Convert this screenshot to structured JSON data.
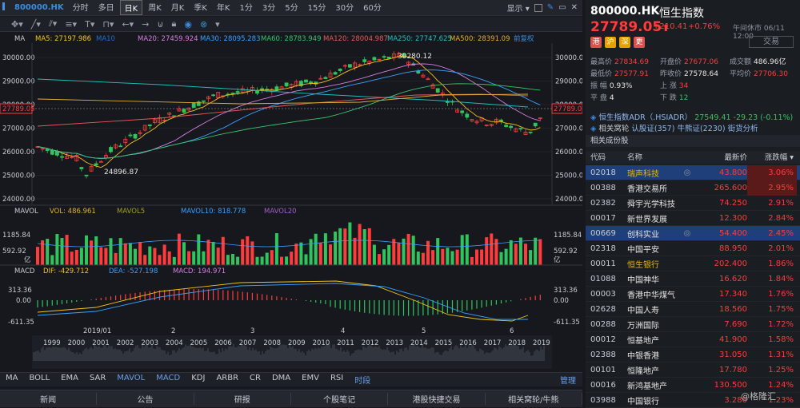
{
  "topbar": {
    "symbol": "800000.HK",
    "periods": [
      "分时",
      "多日",
      "日K",
      "周K",
      "月K",
      "季K",
      "年K",
      "1分",
      "3分",
      "5分",
      "15分",
      "30分",
      "60分"
    ],
    "active_period": "日K",
    "display_label": "显示"
  },
  "indicators": {
    "ma_label": "MA",
    "ma": [
      {
        "label": "MA5: 27197.986",
        "color": "#f0c419"
      },
      {
        "label": "MA10",
        "color": "#1f6fd0"
      },
      {
        "label": "MA20: 27459.924",
        "color": "#d67fe0"
      },
      {
        "label": "MA30: 28095.283",
        "color": "#3aa0ff"
      },
      {
        "label": "MA60: 28783.949",
        "color": "#36c46b"
      },
      {
        "label": "MA120: 28004.987",
        "color": "#e85a5a"
      },
      {
        "label": "MA250: 27747.625",
        "color": "#20c0c0"
      },
      {
        "label": "MA500: 28391.09",
        "color": "#e0b030"
      }
    ],
    "fq": "前复权",
    "vol_label": "MAVOL",
    "vol": [
      {
        "label": "VOL: 486.961",
        "color": "#e0b030"
      },
      {
        "label": "MAVOL5",
        "color": "#a0a020"
      },
      {
        "label": "MAVOL10: 818.778",
        "color": "#3aa0ff"
      },
      {
        "label": "MAVOL20",
        "color": "#a060c0"
      }
    ],
    "macd_label": "MACD",
    "macd": [
      {
        "label": "DIF: -429.712",
        "color": "#f0c419"
      },
      {
        "label": "DEA: -527.198",
        "color": "#3aa0ff"
      },
      {
        "label": "MACD: 194.971",
        "color": "#d67fe0"
      }
    ]
  },
  "price_axis": {
    "ticks": [
      "30000.00",
      "29000.00",
      "28000.00",
      "27000.00",
      "26000.00",
      "25000.00",
      "24000.00"
    ],
    "right_ticks": [
      "30000.00",
      "29000.00",
      "28000.00",
      "27000.00",
      "26000.00",
      "25000.00",
      "24000.00"
    ],
    "current": "27789.05",
    "high_label": "30280.12",
    "low_label": "24896.87"
  },
  "vol_axis": {
    "top": "1185.84",
    "mid": "592.92",
    "unit": "亿"
  },
  "macd_axis": {
    "top": "313.36",
    "zero": "0.00",
    "bottom": "-611.35"
  },
  "timeline": {
    "month_labels": [
      "2019/01",
      "2",
      "3",
      "4",
      "5",
      "6"
    ],
    "year_labels": [
      "1999",
      "2000",
      "2001",
      "2002",
      "2003",
      "2004",
      "2005",
      "2006",
      "2007",
      "2008",
      "2009",
      "2010",
      "2011",
      "2012",
      "2013",
      "2014",
      "2015",
      "2016",
      "2017",
      "2018",
      "2019"
    ]
  },
  "tabs": [
    "MA",
    "BOLL",
    "EMA",
    "SAR",
    "MAVOL",
    "MACD",
    "KDJ",
    "ARBR",
    "CR",
    "DMA",
    "EMV",
    "RSI",
    "时段"
  ],
  "manage": "管理",
  "bottom_nav": [
    "新闻",
    "公告",
    "研报",
    "个股笔记",
    "港股快捷交易",
    "相关窝轮/牛熊"
  ],
  "quote": {
    "symbol": "800000.HK",
    "name": "恒生指数",
    "price": "27789.05",
    "change": "+210.41",
    "change_pct": "+0.76%",
    "status_time": "午间休市 06/11 12:00",
    "trade": "交易",
    "badges": [
      "港",
      "沪",
      "深",
      "更"
    ],
    "stats": [
      {
        "k": "最高价",
        "v": "27834.69",
        "c": "red"
      },
      {
        "k": "开盘价",
        "v": "27677.06",
        "c": "red"
      },
      {
        "k": "成交额",
        "v": "486.96亿",
        "c": "white"
      },
      {
        "k": "最低价",
        "v": "27577.91",
        "c": "red"
      },
      {
        "k": "昨收价",
        "v": "27578.64",
        "c": "white"
      },
      {
        "k": "平均价",
        "v": "27706.30",
        "c": "red"
      },
      {
        "k": "振    幅",
        "v": "0.93%",
        "c": "white"
      },
      {
        "k": "上    涨",
        "v": "34",
        "c": "red"
      },
      {
        "k": "",
        "v": "",
        "c": "white"
      },
      {
        "k": "平    盘",
        "v": "4",
        "c": "white"
      },
      {
        "k": "下    跌",
        "v": "12",
        "c": "green"
      },
      {
        "k": "",
        "v": "",
        "c": "white"
      }
    ],
    "adr_name": "恒生指数ADR（.HSIADR）",
    "adr_price": "27549.41",
    "adr_change": "-29.23 (-0.11%)",
    "related_label": "相关窝轮",
    "related_items": [
      "认股证(357)",
      "牛熊证(2230)",
      "街货分析"
    ],
    "constituents_title": "相关成份股",
    "table_headers": [
      "代码",
      "名称",
      "最新价",
      "涨跌幅"
    ],
    "rows": [
      {
        "code": "02018",
        "name": "瑞声科技",
        "price": "43.800",
        "pct": "3.06%",
        "sel": true,
        "y": true,
        "eye": true
      },
      {
        "code": "00388",
        "name": "香港交易所",
        "price": "265.600",
        "pct": "2.95%"
      },
      {
        "code": "02382",
        "name": "舜宇光学科技",
        "price": "74.250",
        "pct": "2.91%"
      },
      {
        "code": "00017",
        "name": "新世界发展",
        "price": "12.300",
        "pct": "2.84%"
      },
      {
        "code": "00669",
        "name": "创科实业",
        "price": "54.400",
        "pct": "2.45%",
        "sel": true,
        "eye": true
      },
      {
        "code": "02318",
        "name": "中国平安",
        "price": "88.950",
        "pct": "2.01%"
      },
      {
        "code": "00011",
        "name": "恒生银行",
        "price": "202.400",
        "pct": "1.86%",
        "y": true
      },
      {
        "code": "01088",
        "name": "中国神华",
        "price": "16.620",
        "pct": "1.84%"
      },
      {
        "code": "00003",
        "name": "香港中华煤气",
        "price": "17.340",
        "pct": "1.76%"
      },
      {
        "code": "02628",
        "name": "中国人寿",
        "price": "18.560",
        "pct": "1.75%"
      },
      {
        "code": "00288",
        "name": "万洲国际",
        "price": "7.690",
        "pct": "1.72%"
      },
      {
        "code": "00012",
        "name": "恒基地产",
        "price": "41.900",
        "pct": "1.58%"
      },
      {
        "code": "02388",
        "name": "中银香港",
        "price": "31.050",
        "pct": "1.31%"
      },
      {
        "code": "00101",
        "name": "恒隆地产",
        "price": "17.780",
        "pct": "1.25%"
      },
      {
        "code": "00016",
        "name": "新鸿基地产",
        "price": "130.500",
        "pct": "1.24%"
      },
      {
        "code": "03988",
        "name": "中国银行",
        "price": "3.280",
        "pct": "1.23%"
      }
    ]
  },
  "watermark": "@格隆汇",
  "colors": {
    "up": "#ff3b3b",
    "down": "#2fc45e",
    "accent": "#3a8dde",
    "bg": "#16181d"
  }
}
